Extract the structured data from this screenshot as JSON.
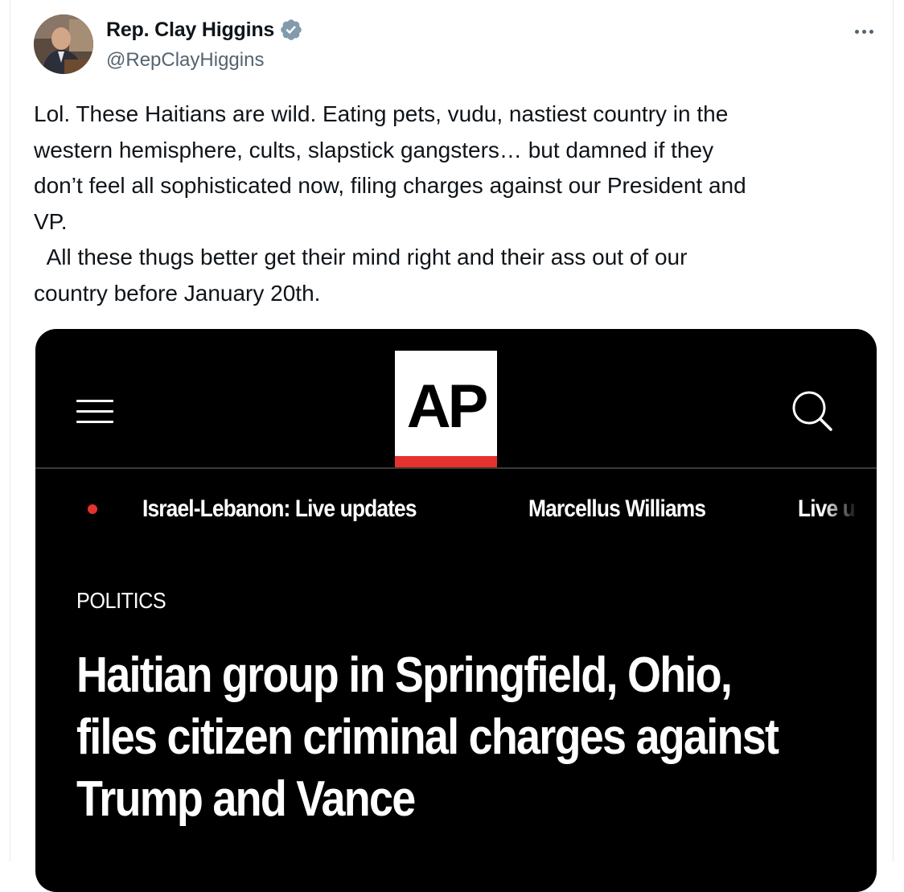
{
  "author": {
    "display_name": "Rep. Clay Higgins",
    "handle": "@RepClayHiggins",
    "verified": true,
    "verified_badge_icon": "verified-badge-icon",
    "verified_color": "#829aab"
  },
  "tweet": {
    "text": "Lol. These Haitians are wild. Eating pets, vudu, nastiest country in the\nwestern hemisphere, cults, slapstick gangsters… but damned if they\ndon’t feel all sophisticated now, filing charges against our President and\nVP.\n  All these thugs better get their mind right and their ass out of our\ncountry before January 20th.",
    "more_icon": "more-horizontal-icon"
  },
  "media": {
    "brand_logo_text": "AP",
    "brand_accent_color": "#e5322d",
    "menu_icon": "hamburger-menu-icon",
    "search_icon": "search-icon",
    "trending": [
      {
        "label": "Israel-Lebanon: Live updates",
        "live": true
      },
      {
        "label": "Marcellus Williams"
      },
      {
        "label": "Live u"
      }
    ],
    "section": "POLITICS",
    "headline": "Haitian group in Springfield, Ohio,\nfiles citizen criminal charges against\nTrump and Vance"
  }
}
